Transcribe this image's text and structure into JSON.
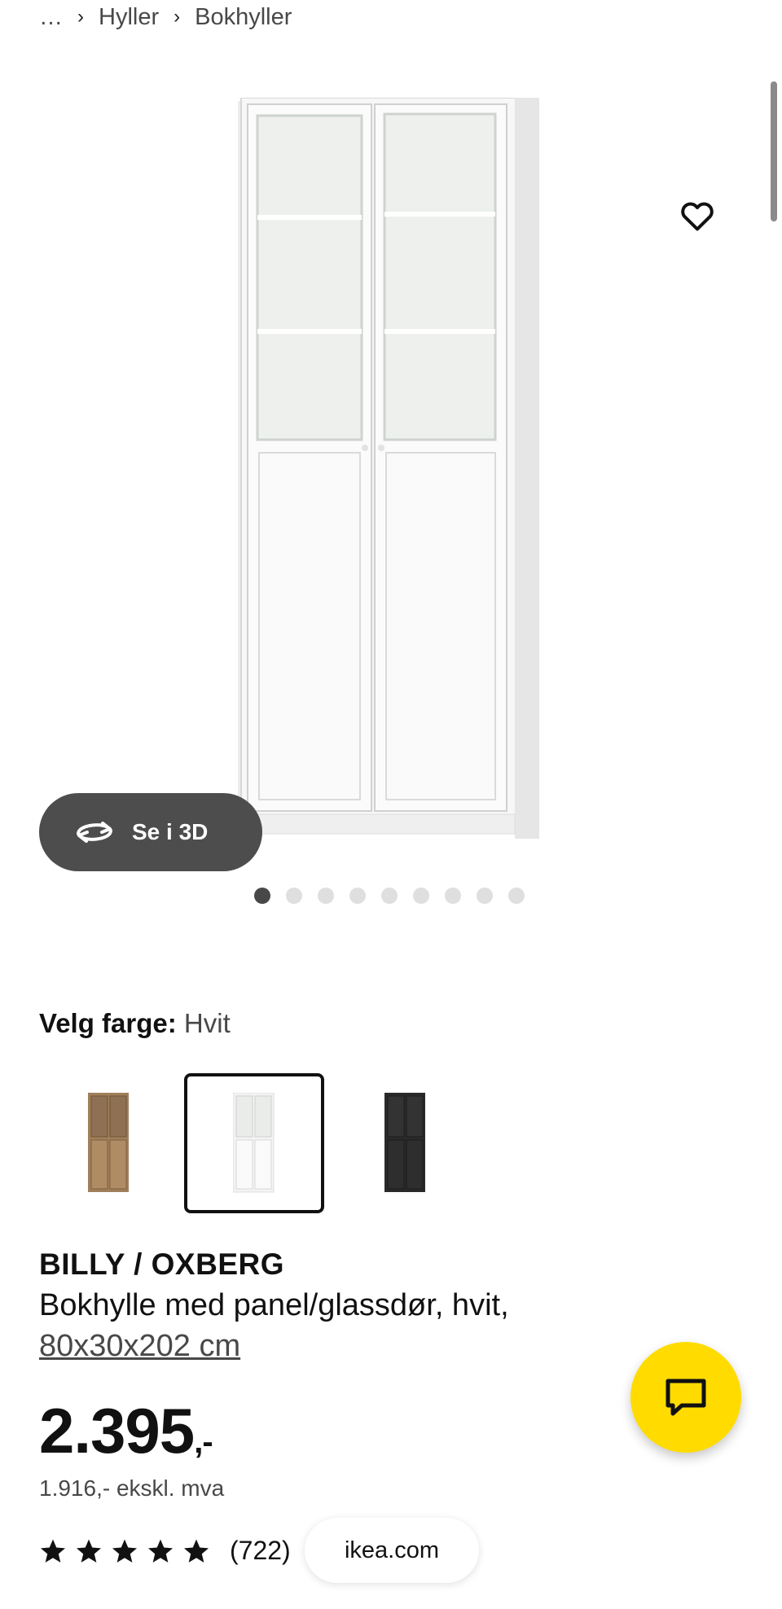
{
  "breadcrumb": {
    "ellipsis": "…",
    "items": [
      "Hyller",
      "Bokhyller"
    ]
  },
  "gallery": {
    "view_3d_label": "Se i 3D",
    "dot_count": 9,
    "active_dot": 1
  },
  "color_picker": {
    "label": "Velg farge:",
    "selected_value": "Hvit",
    "swatches": [
      "oak",
      "white",
      "black"
    ],
    "selected_index": 1
  },
  "product": {
    "name": "BILLY / OXBERG",
    "description": "Bokhylle med panel/glassdør, hvit,",
    "dimensions": "80x30x202 cm",
    "price_main": "2.395",
    "price_suffix": ",-",
    "price_ex_vat": "1.916,- ekskl. mva",
    "rating_stars": 5,
    "rating_count": "(722)"
  },
  "browser": {
    "url": "ikea.com"
  },
  "colors": {
    "accent": "#ffdb00",
    "dark_button": "#4d4d4d",
    "text": "#111111",
    "muted": "#484848"
  },
  "icons": {
    "favorite": "heart-icon",
    "view_3d": "rotate-icon",
    "chat": "chat-bubble-icon",
    "rating": "star-icon"
  }
}
